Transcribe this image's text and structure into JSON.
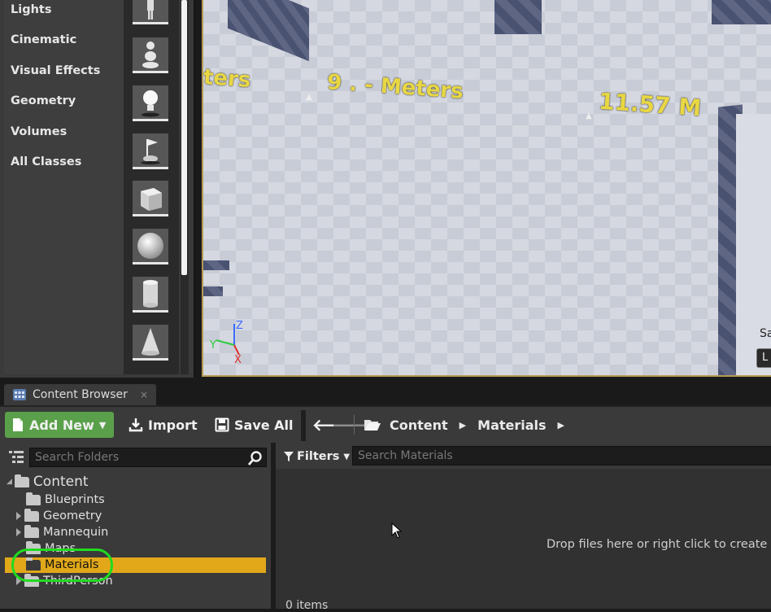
{
  "modes_panel": {
    "categories": [
      "Lights",
      "Cinematic",
      "Visual Effects",
      "Geometry",
      "Volumes",
      "All Classes"
    ]
  },
  "viewport": {
    "measurements": [
      "ters",
      "9 . - Meters",
      "11.57 M"
    ],
    "axis_labels": {
      "z": "Z",
      "y": "Y",
      "x": "X"
    },
    "edge_text": "Sa",
    "edge_button": "L"
  },
  "content_browser": {
    "tab_title": "Content Browser",
    "tab_close": "×",
    "toolbar": {
      "add_new": "Add New",
      "import": "Import",
      "save_all": "Save All"
    },
    "breadcrumb": [
      "Content",
      "Materials"
    ],
    "search_folders_placeholder": "Search Folders",
    "filters_label": "Filters",
    "search_materials_placeholder": "Search Materials",
    "tree": {
      "root": "Content",
      "folders": [
        "Blueprints",
        "Geometry",
        "Mannequin",
        "Maps",
        "Materials",
        "ThirdPerson"
      ],
      "selected": "Materials"
    },
    "drop_hint": "Drop files here or right click to create co",
    "items_count": "0 items"
  },
  "colors": {
    "add_new_green": "#5aa04a",
    "selection_orange": "#e2a81a",
    "annotation_green": "#1fdc1f",
    "measure_yellow": "#e8d743"
  }
}
